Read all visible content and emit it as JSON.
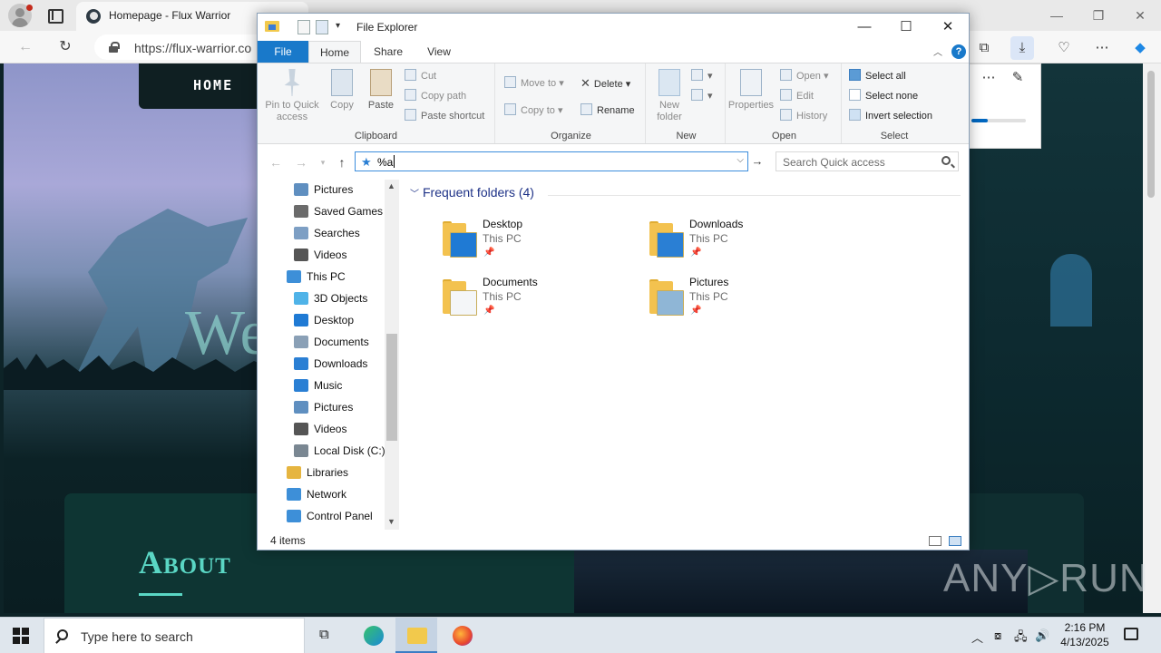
{
  "browser": {
    "tab_title": "Homepage - Flux Warrior",
    "url": "https://flux-warrior.co",
    "window_controls": {
      "minimize": "—",
      "restore": "❐",
      "close": "✕"
    }
  },
  "website": {
    "nav_home": "HOME",
    "hero_text": "We",
    "about_title": "About"
  },
  "watermark": "ANY▷RUN",
  "explorer": {
    "title": "File Explorer",
    "window_controls": {
      "minimize": "—",
      "maximize": "☐",
      "close": "✕"
    },
    "ribbon_tabs": [
      "File",
      "Home",
      "Share",
      "View"
    ],
    "ribbon": {
      "clipboard": {
        "label": "Clipboard",
        "pin": "Pin to Quick access",
        "copy": "Copy",
        "paste": "Paste",
        "cut": "Cut",
        "copy_path": "Copy path",
        "paste_shortcut": "Paste shortcut"
      },
      "organize": {
        "label": "Organize",
        "move_to": "Move to",
        "copy_to": "Copy to",
        "delete": "Delete",
        "rename": "Rename"
      },
      "new": {
        "label": "New",
        "new_folder": "New folder"
      },
      "open": {
        "label": "Open",
        "properties": "Properties",
        "open": "Open",
        "edit": "Edit",
        "history": "History"
      },
      "select": {
        "label": "Select",
        "select_all": "Select all",
        "select_none": "Select none",
        "invert": "Invert selection"
      }
    },
    "address_value": "%a",
    "search_placeholder": "Search Quick access",
    "nav_items": [
      {
        "label": "Pictures",
        "icon": "pictures-icon",
        "color": "#5f8fc0"
      },
      {
        "label": "Saved Games",
        "icon": "saved-games-icon",
        "color": "#6b6b6b"
      },
      {
        "label": "Searches",
        "icon": "searches-icon",
        "color": "#7d9fc4"
      },
      {
        "label": "Videos",
        "icon": "videos-icon",
        "color": "#555"
      },
      {
        "label": "This PC",
        "icon": "this-pc-icon",
        "color": "#3d8fd8"
      },
      {
        "label": "3D Objects",
        "icon": "3d-objects-icon",
        "color": "#4fb3e8"
      },
      {
        "label": "Desktop",
        "icon": "desktop-icon",
        "color": "#1f7ad4"
      },
      {
        "label": "Documents",
        "icon": "documents-icon",
        "color": "#8aa0b6"
      },
      {
        "label": "Downloads",
        "icon": "downloads-icon",
        "color": "#2a7fd4"
      },
      {
        "label": "Music",
        "icon": "music-icon",
        "color": "#2a7fd4"
      },
      {
        "label": "Pictures",
        "icon": "pictures-icon",
        "color": "#5f8fc0"
      },
      {
        "label": "Videos",
        "icon": "videos-icon",
        "color": "#555"
      },
      {
        "label": "Local Disk (C:)",
        "icon": "local-disk-icon",
        "color": "#7a8792"
      },
      {
        "label": "Libraries",
        "icon": "libraries-icon",
        "color": "#e6b540"
      },
      {
        "label": "Network",
        "icon": "network-icon",
        "color": "#3d8fd8"
      },
      {
        "label": "Control Panel",
        "icon": "control-panel-icon",
        "color": "#3d8fd8"
      }
    ],
    "group_header": "Frequent folders (4)",
    "folders": [
      {
        "name": "Desktop",
        "location": "This PC",
        "overlay": "desktop",
        "overlay_color": "#1f7ad4"
      },
      {
        "name": "Downloads",
        "location": "This PC",
        "overlay": "downloads",
        "overlay_color": "#2a7fd4"
      },
      {
        "name": "Documents",
        "location": "This PC",
        "overlay": "documents",
        "overlay_color": "#f4f6f8"
      },
      {
        "name": "Pictures",
        "location": "This PC",
        "overlay": "pictures",
        "overlay_color": "#8fb6d6"
      }
    ],
    "status": "4 items"
  },
  "taskbar": {
    "search_placeholder": "Type here to search",
    "time": "2:16 PM",
    "date": "4/13/2025"
  }
}
